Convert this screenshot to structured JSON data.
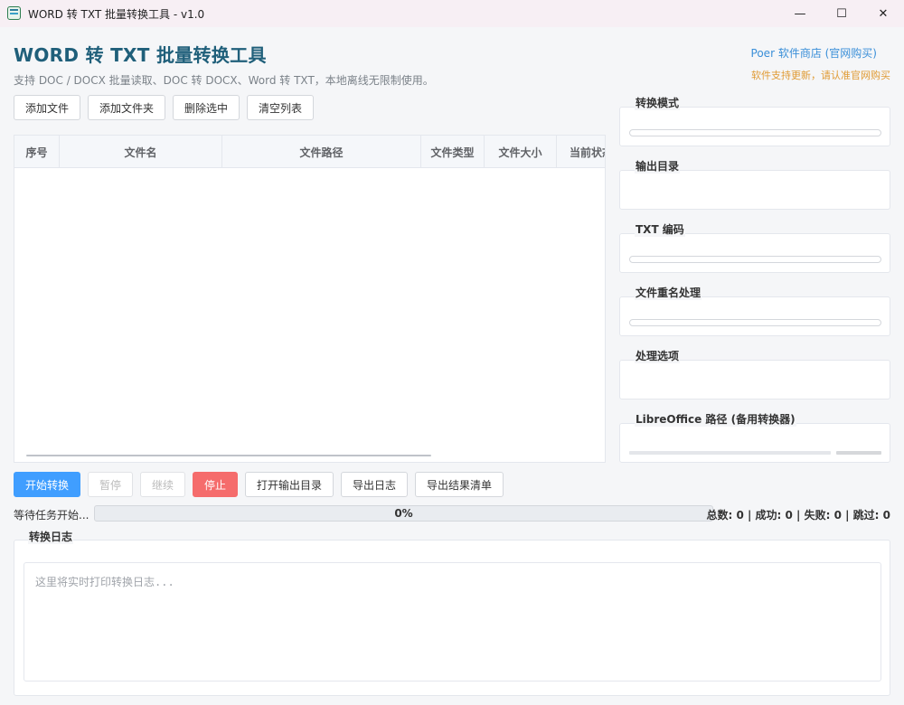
{
  "window": {
    "title": "WORD 转 TXT 批量转换工具 - v1.0",
    "controls": {
      "minimize": "—",
      "maximize": "☐",
      "close": "✕"
    }
  },
  "header": {
    "title": "WORD 转 TXT 批量转换工具",
    "subtitle": "支持 DOC / DOCX 批量读取、DOC 转 DOCX、Word 转 TXT，本地离线无限制使用。",
    "store_link": "Poer 软件商店 (官网购买)",
    "store_note": "软件支持更新，请认准官网购买"
  },
  "toolbar": {
    "add_files": "添加文件",
    "add_folder": "添加文件夹",
    "delete_selected": "删除选中",
    "clear_list": "清空列表"
  },
  "table": {
    "columns": [
      "序号",
      "文件名",
      "文件路径",
      "文件类型",
      "文件大小",
      "当前状态"
    ],
    "rows": []
  },
  "settings": {
    "convert_mode": "转换模式",
    "output_dir": "输出目录",
    "txt_encoding": "TXT 编码",
    "rename": "文件重名处理",
    "options": "处理选项",
    "libreoffice_path": "LibreOffice 路径 (备用转换器)"
  },
  "actions": {
    "start": "开始转换",
    "pause": "暂停",
    "resume": "继续",
    "stop": "停止",
    "open_output": "打开输出目录",
    "export_log": "导出日志",
    "export_results": "导出结果清单"
  },
  "status": {
    "text": "等待任务开始...",
    "progress": 0,
    "progress_label": "0%",
    "stats": "总数: 0 | 成功: 0 | 失败: 0 | 跳过: 0"
  },
  "log": {
    "title": "转换日志",
    "placeholder": "这里将实时打印转换日志..."
  },
  "colors": {
    "title": "#1f5f7a",
    "primary": "#409eff",
    "danger": "#f56c6c",
    "link": "#3a8fd8",
    "note": "#e09b35"
  }
}
